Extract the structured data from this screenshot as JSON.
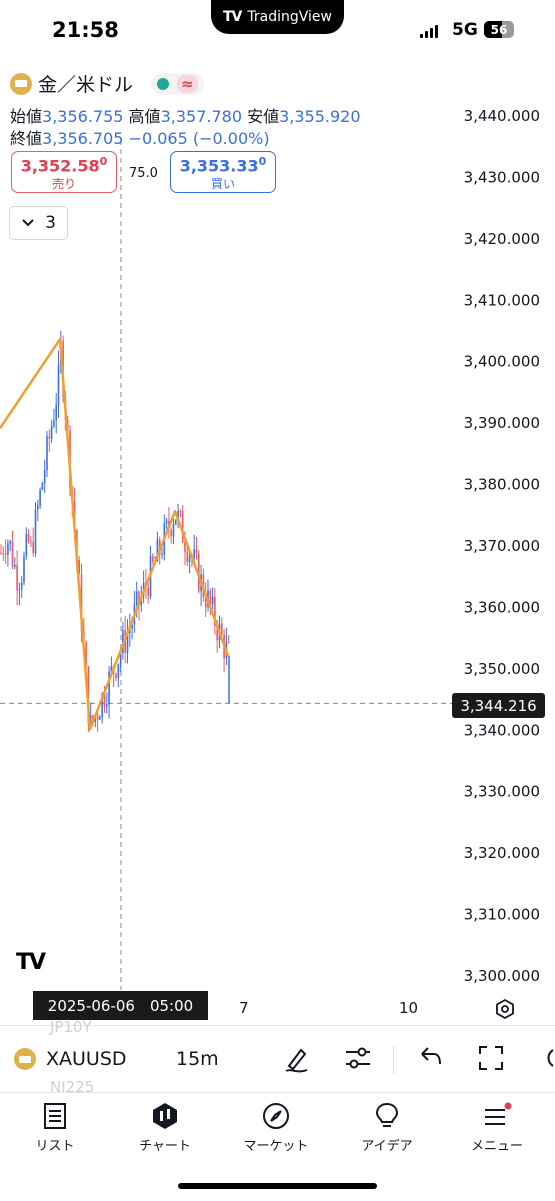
{
  "status": {
    "time": "21:58",
    "app_pill": "TradingView",
    "network": "5G",
    "battery": "56"
  },
  "symbol": {
    "name": "金／米ドル",
    "open_label": "始値",
    "open": "3,356.755",
    "high_label": "高値",
    "high": "3,357.780",
    "low_label": "安値",
    "low": "3,355.920",
    "close_label": "終値",
    "close": "3,356.705",
    "change": "−0.065 (−0.00%)"
  },
  "trade": {
    "sell_price": "3,352.58",
    "sell_sup": "0",
    "sell_label": "売り",
    "buy_price": "3,353.33",
    "buy_sup": "0",
    "buy_label": "買い",
    "spread": "75.0"
  },
  "indicator_count": "3",
  "chart_data": {
    "type": "candlestick",
    "y_ticks": [
      "3,440.000",
      "3,430.000",
      "3,420.000",
      "3,410.000",
      "3,400.000",
      "3,390.000",
      "3,380.000",
      "3,370.000",
      "3,360.000",
      "3,350.000",
      "3,340.000",
      "3,330.000",
      "3,320.000",
      "3,310.000",
      "3,300.000"
    ],
    "ylim": [
      3295,
      3445
    ],
    "last_price": "3,344.216",
    "crosshair_date": "2025-06-06　05:00",
    "x_ticks": [
      "7",
      "10"
    ],
    "zigzag": [
      3389,
      3403.5,
      3340,
      3375.5,
      3352
    ],
    "colors": {
      "up": "#3b6fe0",
      "down": "#e85a66",
      "zigzag": "#f0a030"
    }
  },
  "toolbar": {
    "symbol": "XAUUSD",
    "interval": "15m",
    "ghost_top": "JP10Y",
    "ghost_bottom": "NI225"
  },
  "nav": {
    "list": "リスト",
    "chart": "チャート",
    "market": "マーケット",
    "ideas": "アイデア",
    "menu": "メニュー"
  }
}
